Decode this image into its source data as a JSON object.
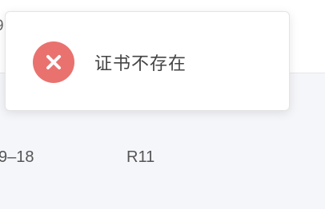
{
  "page": {
    "top_fragment": "9"
  },
  "table": {
    "row": {
      "date_fragment": "9–18",
      "code": "R11"
    }
  },
  "toast": {
    "type": "error",
    "icon": "close-circle-icon",
    "message": "证书不存在",
    "colors": {
      "icon_background": "#e9726f",
      "icon_glyph": "#ffffff"
    }
  }
}
